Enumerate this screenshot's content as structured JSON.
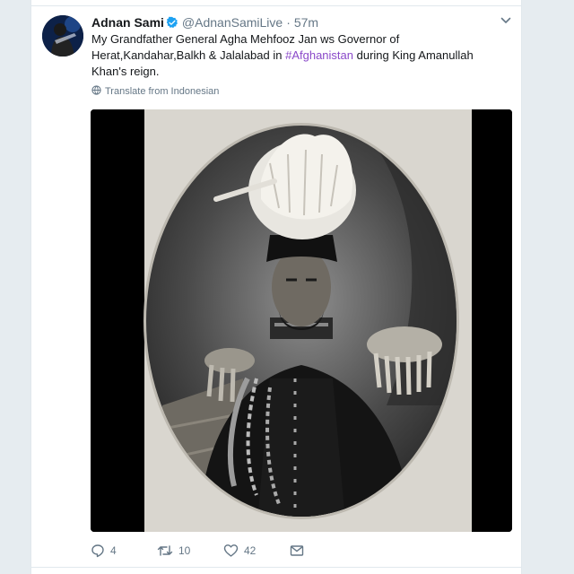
{
  "tweet": {
    "author_name": "Adnan Sami",
    "handle": "@AdnanSamiLive",
    "separator": "·",
    "time": "57m",
    "text_before": "My Grandfather General Agha Mehfooz Jan ws Governor of Herat,Kandahar,Balkh & Jalalabad in ",
    "hashtag": "#Afghanistan",
    "text_after": " during King Amanullah Khan's reign.",
    "translate_label": "Translate from Indonesian"
  },
  "actions": {
    "reply_count": "4",
    "retweet_count": "10",
    "like_count": "42"
  },
  "colors": {
    "accent": "#1da1f2",
    "hashtag": "#8a49c9",
    "secondary_text": "#657786"
  },
  "icons": {
    "verified": "verified-badge-icon",
    "caret": "chevron-down-icon",
    "translate": "globe-icon",
    "reply": "reply-icon",
    "retweet": "retweet-icon",
    "like": "heart-icon",
    "dm": "envelope-icon"
  }
}
